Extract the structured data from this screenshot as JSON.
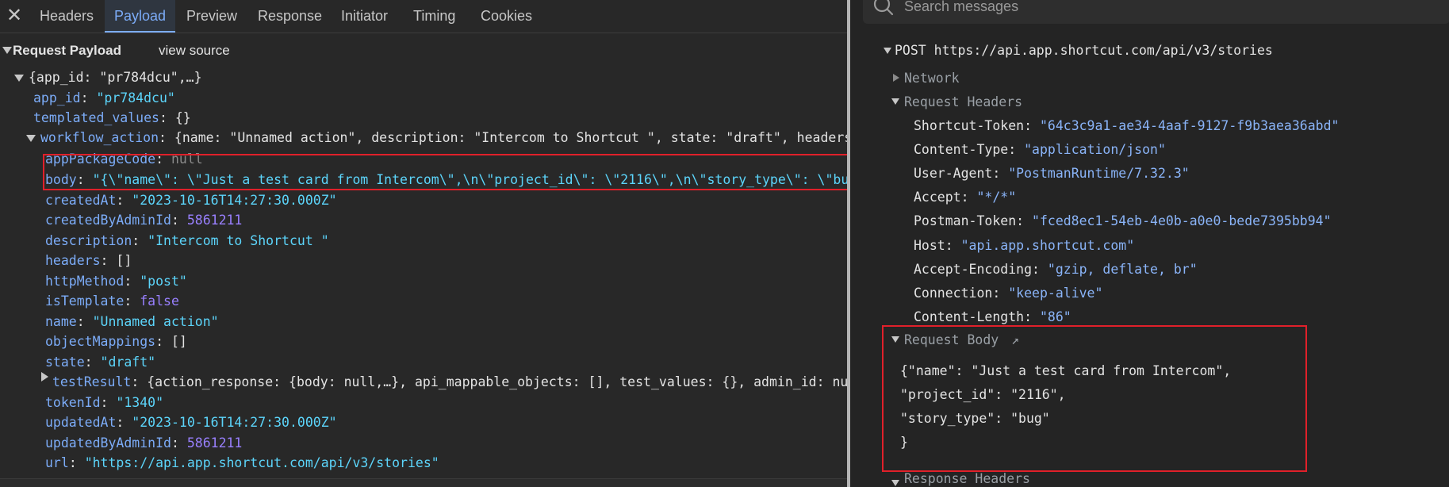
{
  "tabs": [
    "Headers",
    "Payload",
    "Preview",
    "Response",
    "Initiator",
    "Timing",
    "Cookies"
  ],
  "active_tab": "Payload",
  "payload": {
    "title": "Request Payload",
    "view_source": "view source",
    "root_summary": "{app_id: \"pr784dcu\",…}",
    "app_id_key": "app_id",
    "app_id_val": "\"pr784dcu\"",
    "templated_key": "templated_values",
    "templated_val": "{}",
    "workflow_key": "workflow_action",
    "workflow_summary": "{name: \"Unnamed action\", description: \"Intercom to Shortcut \", state: \"draft\", headers",
    "fields": [
      {
        "key": "appPackageCode",
        "val": "null",
        "type": "null"
      },
      {
        "key": "body",
        "val": "\"{\\\"name\\\": \\\"Just a test card from Intercom\\\",\\n\\\"project_id\\\": \\\"2116\\\",\\n\\\"story_type\\\": \\\"bu",
        "type": "string"
      },
      {
        "key": "createdAt",
        "val": "\"2023-10-16T14:27:30.000Z\"",
        "type": "string"
      },
      {
        "key": "createdByAdminId",
        "val": "5861211",
        "type": "number"
      },
      {
        "key": "description",
        "val": "\"Intercom to Shortcut \"",
        "type": "string"
      },
      {
        "key": "headers",
        "val": "[]",
        "type": "plain"
      },
      {
        "key": "httpMethod",
        "val": "\"post\"",
        "type": "string"
      },
      {
        "key": "isTemplate",
        "val": "false",
        "type": "bool"
      },
      {
        "key": "name",
        "val": "\"Unnamed action\"",
        "type": "string"
      },
      {
        "key": "objectMappings",
        "val": "[]",
        "type": "plain"
      },
      {
        "key": "state",
        "val": "\"draft\"",
        "type": "string"
      },
      {
        "key": "testResult",
        "val": "{action_response: {body: null,…}, api_mappable_objects: [], test_values: {}, admin_id: nu",
        "type": "plain"
      },
      {
        "key": "tokenId",
        "val": "\"1340\"",
        "type": "string"
      },
      {
        "key": "updatedAt",
        "val": "\"2023-10-16T14:27:30.000Z\"",
        "type": "string"
      },
      {
        "key": "updatedByAdminId",
        "val": "5861211",
        "type": "number"
      },
      {
        "key": "url",
        "val": "\"https://api.app.shortcut.com/api/v3/stories\"",
        "type": "string"
      }
    ]
  },
  "search": {
    "placeholder": "Search messages"
  },
  "request": {
    "line": "POST https://api.app.shortcut.com/api/v3/stories",
    "network_label": "Network",
    "req_headers_label": "Request Headers",
    "headers": [
      {
        "key": "Shortcut-Token",
        "val": "\"64c3c9a1-ae34-4aaf-9127-f9b3aea36abd\""
      },
      {
        "key": "Content-Type",
        "val": "\"application/json\""
      },
      {
        "key": "User-Agent",
        "val": "\"PostmanRuntime/7.32.3\""
      },
      {
        "key": "Accept",
        "val": "\"*/*\""
      },
      {
        "key": "Postman-Token",
        "val": "\"fced8ec1-54eb-4e0b-a0e0-bede7395bb94\""
      },
      {
        "key": "Host",
        "val": "\"api.app.shortcut.com\""
      },
      {
        "key": "Accept-Encoding",
        "val": "\"gzip, deflate, br\""
      },
      {
        "key": "Connection",
        "val": "\"keep-alive\""
      },
      {
        "key": "Content-Length",
        "val": "\"86\""
      }
    ],
    "req_body_label": "Request Body",
    "body_lines": [
      "{\"name\": \"Just a test card from Intercom\",",
      "\"project_id\": \"2116\",",
      "\"story_type\": \"bug\"",
      "}"
    ],
    "resp_headers_label": "Response Headers"
  },
  "colors": {
    "accent": "#7cacf8",
    "highlight": "#e0202a",
    "string": "#5cd5fb",
    "number": "#9980ff"
  }
}
